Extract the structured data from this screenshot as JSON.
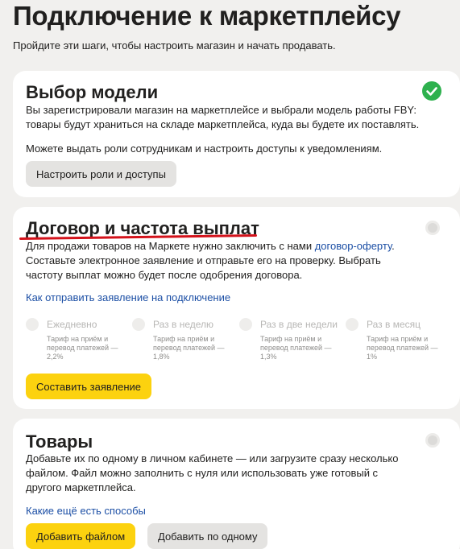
{
  "page": {
    "title": "Подключение к маркетплейсу",
    "subtitle": "Пройдите эти шаги, чтобы настроить магазин и начать продавать."
  },
  "step1": {
    "title": "Выбор модели",
    "text1": "Вы зарегистрировали магазин на маркетплейсе и выбрали модель работы FBY: товары будут храниться на складе маркетплейса, куда вы будете их поставлять.",
    "text2": "Можете выдать роли сотрудникам и настроить доступы к уведомлениям.",
    "button": "Настроить роли и доступы",
    "status": "done"
  },
  "step2": {
    "title": "Договор и частота выплат",
    "text_before_link": "Для продажи товаров на Маркете нужно заключить с нами ",
    "inline_link": "договор-оферту",
    "text_after_link": ". Составьте электронное заявление и отправьте его на проверку. Выбрать частоту выплат можно будет после одобрения договора.",
    "link": "Как отправить заявление на подключение",
    "frequencies": [
      {
        "label": "Ежедневно",
        "note": "Тариф на приём и перевод платежей — 2,2%"
      },
      {
        "label": "Раз в неделю",
        "note": "Тариф на приём и перевод платежей — 1,8%"
      },
      {
        "label": "Раз в две недели",
        "note": "Тариф на приём и перевод платежей — 1,3%"
      },
      {
        "label": "Раз в месяц",
        "note": "Тариф на приём и перевод платежей — 1%"
      }
    ],
    "button": "Составить заявление",
    "status": "pending",
    "highlight_color": "#d4121b"
  },
  "step3": {
    "title": "Товары",
    "text": "Добавьте их по одному в личном кабинете — или загрузите сразу несколько файлом. Файл можно заполнить с нуля или использовать уже готовый с другого маркетплейса.",
    "link": "Какие ещё есть способы",
    "button_primary": "Добавить файлом",
    "button_secondary": "Добавить по одному",
    "status": "pending"
  },
  "colors": {
    "accent_yellow": "#fcd20f",
    "success_green": "#2eb14e",
    "link_blue": "#1c4fa5"
  }
}
